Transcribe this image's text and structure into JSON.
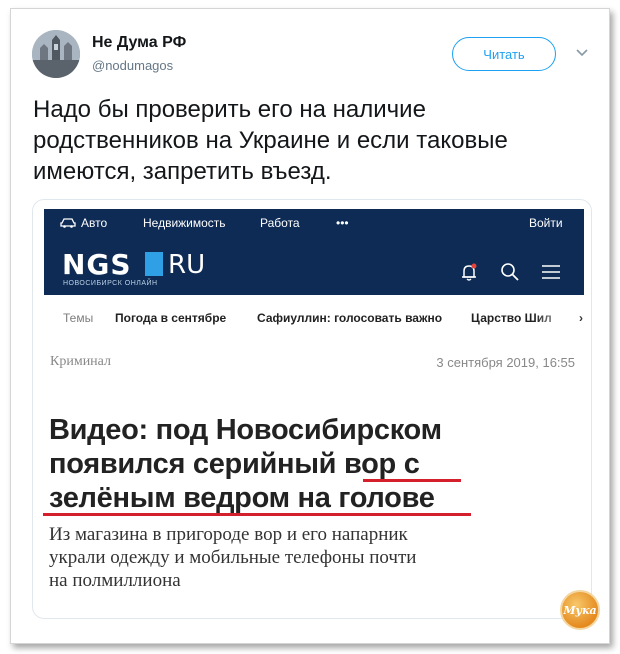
{
  "tweet": {
    "author_name": "Не Дума РФ",
    "author_handle": "@nodumagos",
    "follow_label": "Читать",
    "text_lines": [
      "Надо бы проверить его на наличие",
      "родственников на Украине и если таковые",
      "имеются, запретить въезд."
    ]
  },
  "article": {
    "topnav": [
      "Авто",
      "Недвижимость",
      "Работа",
      "•••",
      "Войти"
    ],
    "logo": "NGS",
    "logo_ru": "RU",
    "logo_subtitle": "НОВОСИБИРСК ОНЛАЙН",
    "topics_label": "Темы",
    "topics": [
      "Погода в сентябре",
      "Сафиуллин: голосовать важно",
      "Царство Шил"
    ],
    "rubric": "Криминал",
    "date": "3 сентября 2019, 16:55",
    "headline_lines": [
      "Видео: под Новосибирском",
      "появился серийный вор с",
      "зелёным ведром на голове"
    ],
    "lead_lines": [
      "Из магазина в пригороде вор и его напарник",
      "украли одежду и мобильные телефоны почти",
      "на полмиллиона"
    ]
  },
  "watermark": "Мука",
  "colors": {
    "ngs_header": "#0d2b55",
    "accent_blue": "#1da1f2",
    "underline_red": "#d61f2d"
  }
}
